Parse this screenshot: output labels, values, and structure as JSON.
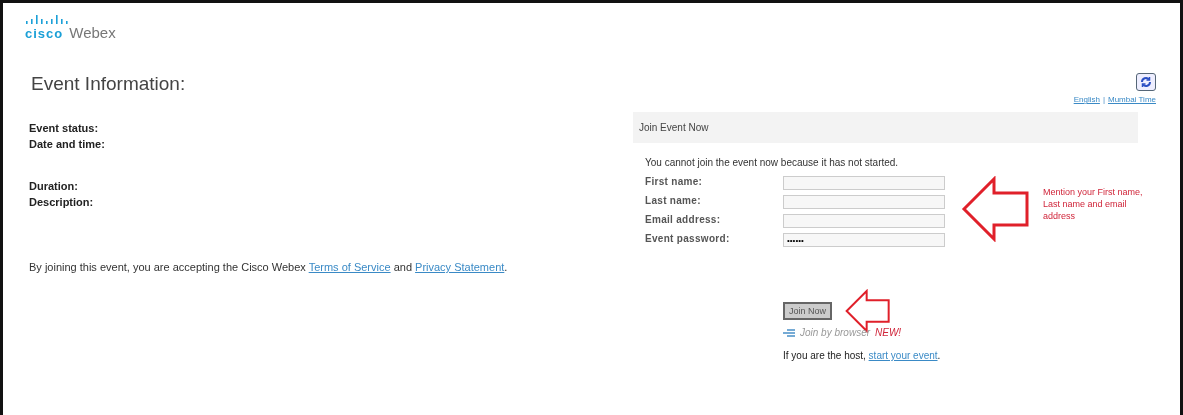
{
  "logo": {
    "mark": "cisco",
    "product": "Webex"
  },
  "page_title": "Event Information:",
  "language_links": [
    {
      "label": "English"
    },
    {
      "label": "Mumbai Time"
    }
  ],
  "language_separator": "|",
  "event_field_groups": [
    [
      {
        "label": "Event status:"
      },
      {
        "label": "Date and time:"
      }
    ],
    [
      {
        "label": "Duration:"
      },
      {
        "label": "Description:"
      }
    ]
  ],
  "terms": {
    "text": "By joining this event, you are accepting the Cisco Webex",
    "link1": "Terms of Service",
    "middle": "and",
    "link2": "Privacy Statement",
    "end": "."
  },
  "join_panel": {
    "title": "Join Event Now",
    "notice": "You cannot join the event now because it has not started.",
    "fields": [
      {
        "label": "First name:"
      },
      {
        "label": "Last name:"
      },
      {
        "label": "Email address:"
      },
      {
        "label": "Event password:",
        "value": "••••••"
      }
    ],
    "join_button": {
      "label": "Join Now",
      "disabled": true
    },
    "browser_link": {
      "label": "Join by browser",
      "badge": "NEW!"
    },
    "host": {
      "text": "If you are the host,",
      "link": "start your event",
      "end": "."
    }
  },
  "annotation": {
    "text": "Mention your First name, Last name and email address"
  }
}
